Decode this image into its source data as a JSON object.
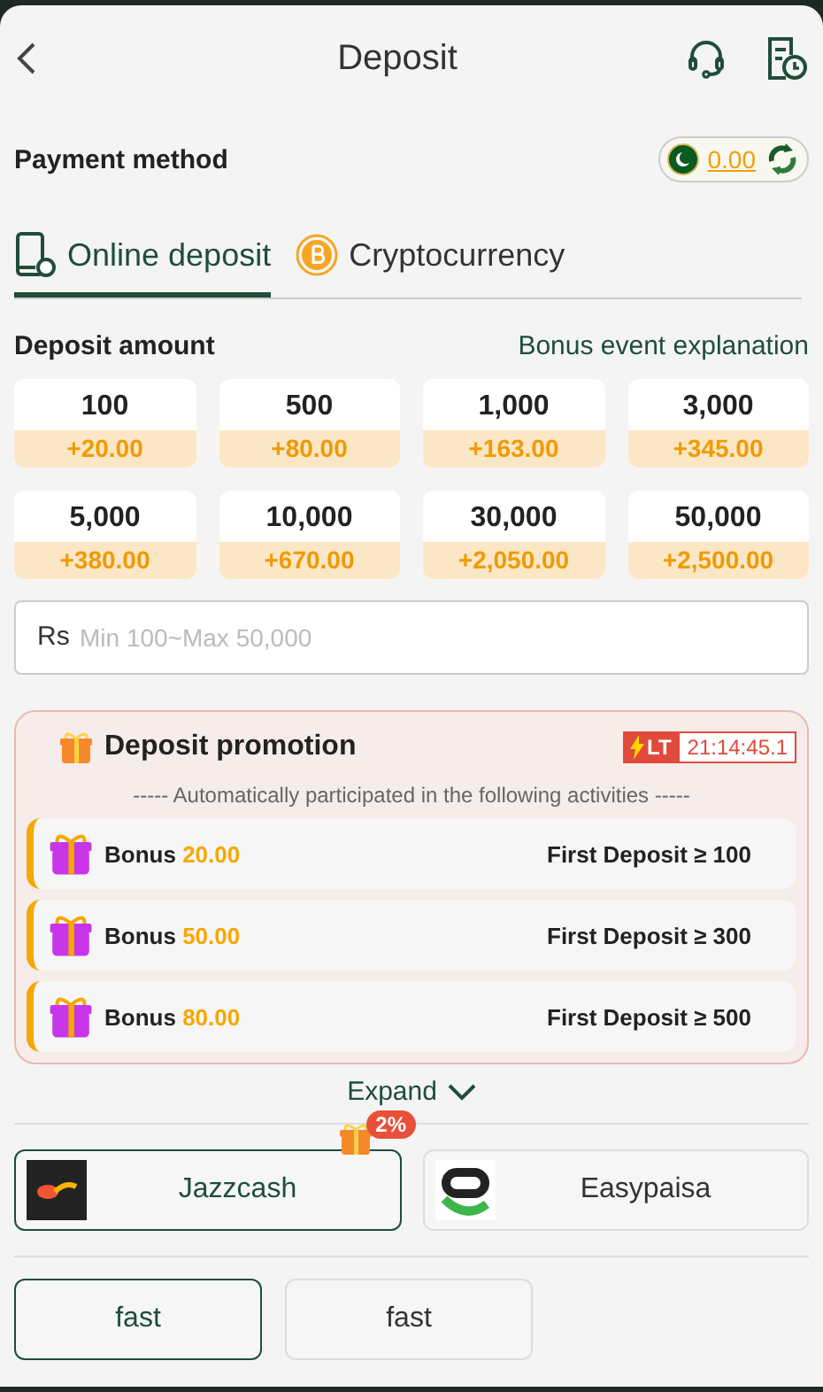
{
  "header": {
    "title": "Deposit"
  },
  "payment_method": {
    "label": "Payment method",
    "balance": "0.00"
  },
  "tabs": [
    {
      "label": "Online deposit",
      "kind": "phone",
      "selected": true
    },
    {
      "label": "Cryptocurrency",
      "kind": "coin",
      "selected": false
    }
  ],
  "deposit_amount": {
    "label": "Deposit amount",
    "link": "Bonus event explanation"
  },
  "amounts": [
    {
      "amount": "100",
      "bonus": "+20.00"
    },
    {
      "amount": "500",
      "bonus": "+80.00"
    },
    {
      "amount": "1,000",
      "bonus": "+163.00"
    },
    {
      "amount": "3,000",
      "bonus": "+345.00"
    },
    {
      "amount": "5,000",
      "bonus": "+380.00"
    },
    {
      "amount": "10,000",
      "bonus": "+670.00"
    },
    {
      "amount": "30,000",
      "bonus": "+2,050.00"
    },
    {
      "amount": "50,000",
      "bonus": "+2,500.00"
    }
  ],
  "amount_field": {
    "prefix": "Rs",
    "placeholder": "Min 100~Max 50,000"
  },
  "promotion": {
    "title": "Deposit promotion",
    "badge": "LT",
    "timer": "21:14:45.1",
    "subtitle": "----- Automatically participated in the following activities -----",
    "items": [
      {
        "label": "Bonus",
        "amount": "20.00",
        "condition": "First Deposit ≥ 100"
      },
      {
        "label": "Bonus",
        "amount": "50.00",
        "condition": "First Deposit ≥ 300"
      },
      {
        "label": "Bonus",
        "amount": "80.00",
        "condition": "First Deposit ≥ 500"
      }
    ],
    "expand": "Expand"
  },
  "methods": [
    {
      "name": "Jazzcash",
      "kind": "jazzcash",
      "selected": true,
      "badge": "2%"
    },
    {
      "name": "Easypaisa",
      "kind": "easypaisa",
      "selected": false
    }
  ],
  "channels": [
    {
      "name": "fast",
      "selected": true
    },
    {
      "name": "fast",
      "selected": false
    }
  ]
}
